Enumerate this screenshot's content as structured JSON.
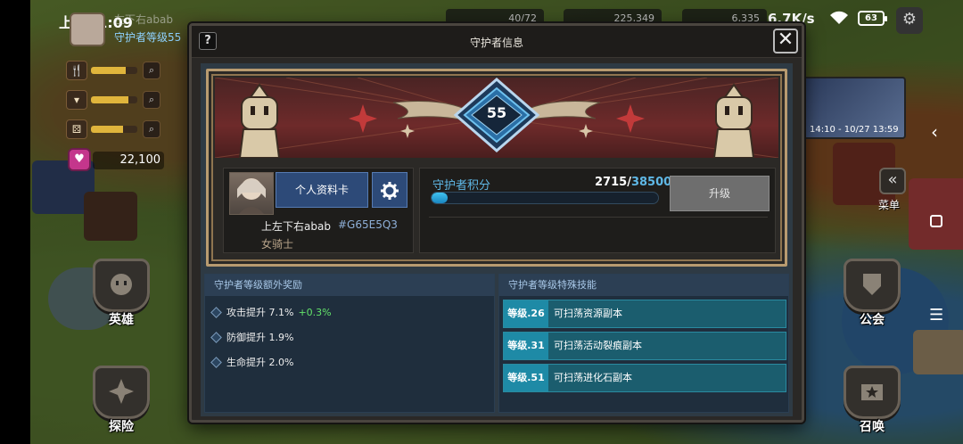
{
  "status_bar": {
    "time": "上午11:09",
    "net_speed": "6.7K/s",
    "battery": "63"
  },
  "hud": {
    "player_name": "左下右abab",
    "guardian_level": "守护者等级55",
    "gems": "22,100",
    "resources": [
      {
        "icon": "fork-icon",
        "fill": 0.75
      },
      {
        "icon": "cup-icon",
        "fill": 0.8
      },
      {
        "icon": "dice-icon",
        "fill": 0.7
      }
    ]
  },
  "side_buttons": {
    "hero": "英雄",
    "explore": "探险",
    "guild": "公会",
    "summon": "召唤",
    "menu": "菜单"
  },
  "event_banner": {
    "time_range": "14:10 - 10/27 13:59"
  },
  "modal": {
    "title": "守护者信息",
    "help": "?",
    "close": "✕",
    "guardian_level": "55",
    "profile": {
      "card_button": "个人资料卡",
      "name": "上左下右abab",
      "id": "#G65E5Q3",
      "class": "女骑士"
    },
    "points": {
      "label": "守护者积分",
      "current": "2715",
      "max": "38500",
      "progress": 0.0705,
      "upgrade_button": "升级"
    },
    "bonus": {
      "title": "守护者等级额外奖励",
      "items": [
        {
          "label": "攻击提升",
          "value": "7.1%",
          "extra": "+0.3%"
        },
        {
          "label": "防御提升",
          "value": "1.9%",
          "extra": ""
        },
        {
          "label": "生命提升",
          "value": "2.0%",
          "extra": ""
        }
      ]
    },
    "skills": {
      "title": "守护者等级特殊技能",
      "items": [
        {
          "level": "等级.26",
          "desc": "可扫荡资源副本"
        },
        {
          "level": "等级.31",
          "desc": "可扫荡活动裂痕副本"
        },
        {
          "level": "等级.51",
          "desc": "可扫荡进化石副本"
        }
      ]
    }
  },
  "colors": {
    "accent_blue": "#5fb8e6",
    "bonus_green": "#63e36a",
    "skill_teal": "#1e8aa6",
    "banner_red": "#6e2a2a",
    "frame_gold": "#b89b70"
  }
}
